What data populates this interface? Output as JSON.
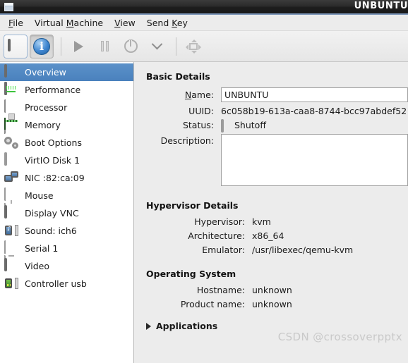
{
  "window": {
    "title": "UNBUNTU",
    "icon": "window-icon"
  },
  "menubar": {
    "items": [
      {
        "label": "File",
        "mnemonic": "F",
        "before": "",
        "after": "ile"
      },
      {
        "label": "Virtual Machine",
        "mnemonic": "M",
        "before": "Virtual ",
        "after": "achine"
      },
      {
        "label": "View",
        "mnemonic": "V",
        "before": "",
        "after": "iew"
      },
      {
        "label": "Send Key",
        "mnemonic": "K",
        "before": "Send ",
        "after": "ey"
      }
    ]
  },
  "toolbar": {
    "buttons": [
      {
        "name": "console-view-button",
        "icon": "monitor-icon",
        "state": "normal"
      },
      {
        "name": "details-view-button",
        "icon": "info-icon",
        "state": "active"
      },
      {
        "name": "run-button",
        "icon": "play-icon",
        "state": "disabled"
      },
      {
        "name": "pause-button",
        "icon": "pause-icon",
        "state": "disabled"
      },
      {
        "name": "shutdown-button",
        "icon": "power-icon",
        "state": "disabled"
      },
      {
        "name": "shutdown-menu-button",
        "icon": "chevron-down-icon",
        "state": "disabled"
      },
      {
        "name": "fullscreen-button",
        "icon": "fullscreen-icon",
        "state": "disabled"
      }
    ]
  },
  "sidebar": {
    "items": [
      {
        "label": "Overview",
        "icon": "screen-icon",
        "selected": true
      },
      {
        "label": "Performance",
        "icon": "performance-icon",
        "selected": false
      },
      {
        "label": "Processor",
        "icon": "cpu-icon",
        "selected": false
      },
      {
        "label": "Memory",
        "icon": "memory-icon",
        "selected": false
      },
      {
        "label": "Boot Options",
        "icon": "gears-icon",
        "selected": false
      },
      {
        "label": "VirtIO Disk 1",
        "icon": "disk-icon",
        "selected": false
      },
      {
        "label": "NIC :82:ca:09",
        "icon": "nic-icon",
        "selected": false
      },
      {
        "label": "Mouse",
        "icon": "mouse-icon",
        "selected": false
      },
      {
        "label": "Display VNC",
        "icon": "screen-icon",
        "selected": false
      },
      {
        "label": "Sound: ich6",
        "icon": "sound-icon",
        "selected": false
      },
      {
        "label": "Serial 1",
        "icon": "serial-icon",
        "selected": false
      },
      {
        "label": "Video",
        "icon": "screen-icon",
        "selected": false
      },
      {
        "label": "Controller usb",
        "icon": "usb-icon",
        "selected": false
      }
    ]
  },
  "main": {
    "basic_details": {
      "title": "Basic Details",
      "name_label_before": "",
      "name_label_mnemonic": "N",
      "name_label_after": "ame:",
      "name_value": "UNBUNTU",
      "name_placeholder": "",
      "uuid_label": "UUID:",
      "uuid_value": "6c058b19-613a-caa8-8744-bcc97abdef52",
      "status_label": "Status:",
      "status_value": "Shutoff",
      "status_icon": "shutoff-monitor-icon",
      "description_label": "Description:",
      "description_value": "",
      "description_placeholder": ""
    },
    "hypervisor_details": {
      "title": "Hypervisor Details",
      "rows": [
        {
          "label": "Hypervisor:",
          "value": "kvm"
        },
        {
          "label": "Architecture:",
          "value": "x86_64"
        },
        {
          "label": "Emulator:",
          "value": "/usr/libexec/qemu-kvm"
        }
      ]
    },
    "operating_system": {
      "title": "Operating System",
      "rows": [
        {
          "label": "Hostname:",
          "value": "unknown"
        },
        {
          "label": "Product name:",
          "value": "unknown"
        }
      ]
    },
    "applications": {
      "label": "Applications",
      "expanded": false
    }
  },
  "watermark": "CSDN @crossoverpptx",
  "colors": {
    "selection_blue": "#4a81bd",
    "panel_gray": "#ececec",
    "titlebar_dark": "#2b2b2b",
    "titlebar_accent": "#7a94b8",
    "info_blue": "#3f86d0"
  }
}
